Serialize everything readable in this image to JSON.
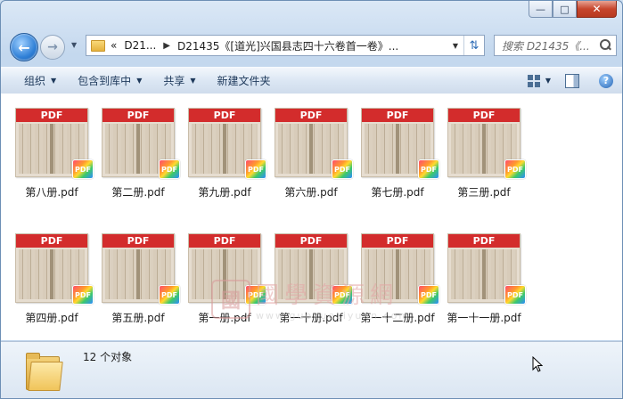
{
  "window": {
    "buttons": {
      "minimize": "—",
      "maximize": "□",
      "close": "✕"
    }
  },
  "nav": {
    "back_icon": "arrow-left-icon",
    "forward_icon": "arrow-right-icon",
    "breadcrumb": {
      "overflow": "«",
      "segments": [
        "D21...",
        "D21435《[道光]兴国县志四十六卷首一卷》..."
      ]
    },
    "search_placeholder": "搜索 D21435《..."
  },
  "toolbar": {
    "organize": "组织",
    "include_library": "包含到库中",
    "share": "共享",
    "new_folder": "新建文件夹"
  },
  "files": [
    {
      "name": "第八册.pdf",
      "banner": "PDF",
      "badge": "PDF"
    },
    {
      "name": "第二册.pdf",
      "banner": "PDF",
      "badge": "PDF"
    },
    {
      "name": "第九册.pdf",
      "banner": "PDF",
      "badge": "PDF"
    },
    {
      "name": "第六册.pdf",
      "banner": "PDF",
      "badge": "PDF"
    },
    {
      "name": "第七册.pdf",
      "banner": "PDF",
      "badge": "PDF"
    },
    {
      "name": "第三册.pdf",
      "banner": "PDF",
      "badge": "PDF"
    },
    {
      "name": "第四册.pdf",
      "banner": "PDF",
      "badge": "PDF"
    },
    {
      "name": "第五册.pdf",
      "banner": "PDF",
      "badge": "PDF"
    },
    {
      "name": "第一册.pdf",
      "banner": "PDF",
      "badge": "PDF"
    },
    {
      "name": "第一十册.pdf",
      "banner": "PDF",
      "badge": "PDF"
    },
    {
      "name": "第一十二册.pdf",
      "banner": "PDF",
      "badge": "PDF"
    },
    {
      "name": "第一十一册.pdf",
      "banner": "PDF",
      "badge": "PDF"
    }
  ],
  "watermark": {
    "seal": "國",
    "text_cn": "國學資源網",
    "url": "www.guoxueziyuan.com"
  },
  "details": {
    "count": "12 个对象"
  }
}
